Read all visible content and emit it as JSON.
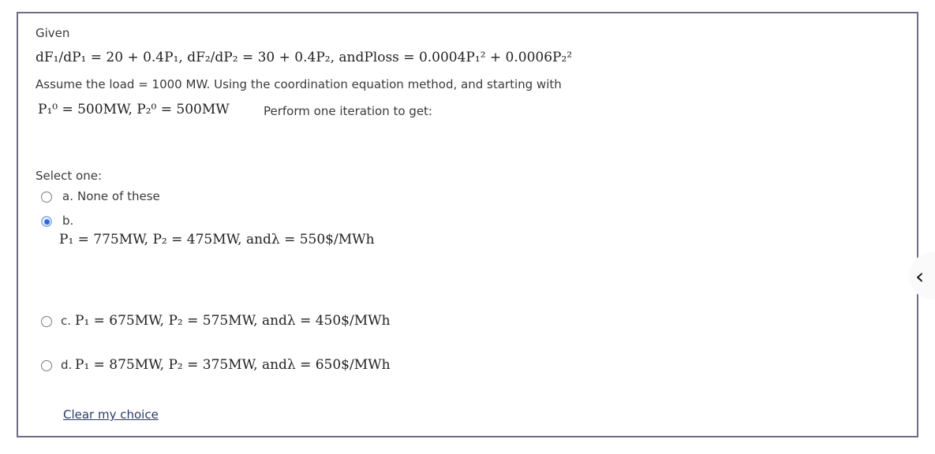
{
  "question": {
    "given_label": "Given",
    "equation": "dF₁/dP₁ = 20 + 0.4P₁, dF₂/dP₂ = 30 + 0.4P₂, andPloss = 0.0004P₁² + 0.0006P₂²",
    "assumption": "Assume  the load = 1000 MW.  Using the coordination equation method,  and starting with",
    "initial_values": "P₁⁰ = 500MW, P₂⁰ = 500MW",
    "instruction": "Perform one iteration to get:"
  },
  "answer": {
    "prompt": "Select one:",
    "options": [
      {
        "letter": "a.",
        "text": "None of these",
        "selected": false
      },
      {
        "letter": "b.",
        "text": "P₁ = 775MW, P₂ = 475MW, andλ = 550$/MWh",
        "selected": true
      },
      {
        "letter": "c.",
        "text": "P₁ = 675MW, P₂ = 575MW, andλ = 450$/MWh",
        "selected": false
      },
      {
        "letter": "d.",
        "text": "P₁ = 875MW, P₂ = 375MW, andλ = 650$/MWh",
        "selected": false
      }
    ],
    "clear_label": "Clear my choice"
  },
  "side_toggle": {
    "icon": "chevron-left-icon",
    "glyph": "‹"
  },
  "colors": {
    "border": "#6c6c84",
    "radio_selected": "#2c6bd8",
    "link": "#2a3a6a"
  }
}
